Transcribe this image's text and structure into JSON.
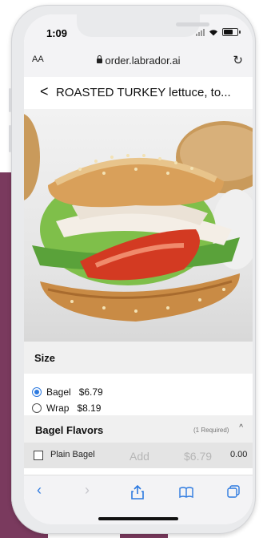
{
  "status_bar": {
    "time": "1:09",
    "battery_level": 0.75
  },
  "browser": {
    "text_size_label": "AA",
    "url": "order.labrador.ai",
    "reload_icon": "reload-icon"
  },
  "page": {
    "back_icon": "<",
    "title": "ROASTED TURKEY lettuce, to..."
  },
  "size": {
    "title": "Size",
    "options": [
      {
        "label": "Bagel",
        "price": "$6.79",
        "selected": true
      },
      {
        "label": "Wrap",
        "price": "$8.19",
        "selected": false
      }
    ]
  },
  "bagel_flavors": {
    "title": "Bagel Flavors",
    "required_text": "(1 Required)",
    "items": [
      {
        "label": "Plain Bagel",
        "price": "0.00"
      }
    ]
  },
  "cart_bar": {
    "add_label": "Add",
    "price": "$6.79"
  },
  "toolbar": {
    "back_icon": "chevron-left-icon",
    "forward_icon": "chevron-right-icon",
    "share_icon": "share-icon",
    "bookmarks_icon": "book-icon",
    "tabs_icon": "tabs-icon"
  },
  "colors": {
    "accent": "#2d7ae0",
    "background_purple": "#7a3a5e"
  }
}
